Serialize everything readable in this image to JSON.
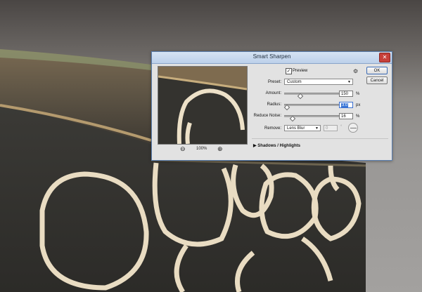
{
  "dialog": {
    "title": "Smart Sharpen",
    "close_glyph": "✕",
    "preview_label": "Preview",
    "preview_checked_glyph": "✓",
    "settings_icon": "gear-icon",
    "preset": {
      "label": "Preset:",
      "value": "Custom"
    },
    "amount": {
      "label": "Amount:",
      "value": "150",
      "unit": "%",
      "fraction": 0.3
    },
    "radius": {
      "label": "Radius:",
      "value": "3.0",
      "unit": "px",
      "fraction": 0.05
    },
    "reduce_noise": {
      "label": "Reduce Noise:",
      "value": "16",
      "unit": "%",
      "fraction": 0.16
    },
    "remove": {
      "label": "Remove:",
      "value": "Lens Blur",
      "angle_value": "0",
      "angle_unit": "°"
    },
    "zoom": {
      "value": "100%",
      "zoom_out_glyph": "⊖",
      "zoom_in_glyph": "⊕"
    },
    "ok_label": "OK",
    "cancel_label": "Cancel",
    "shadows_highlights": {
      "glyph": "▶",
      "label": "Shadows / Highlights"
    }
  }
}
